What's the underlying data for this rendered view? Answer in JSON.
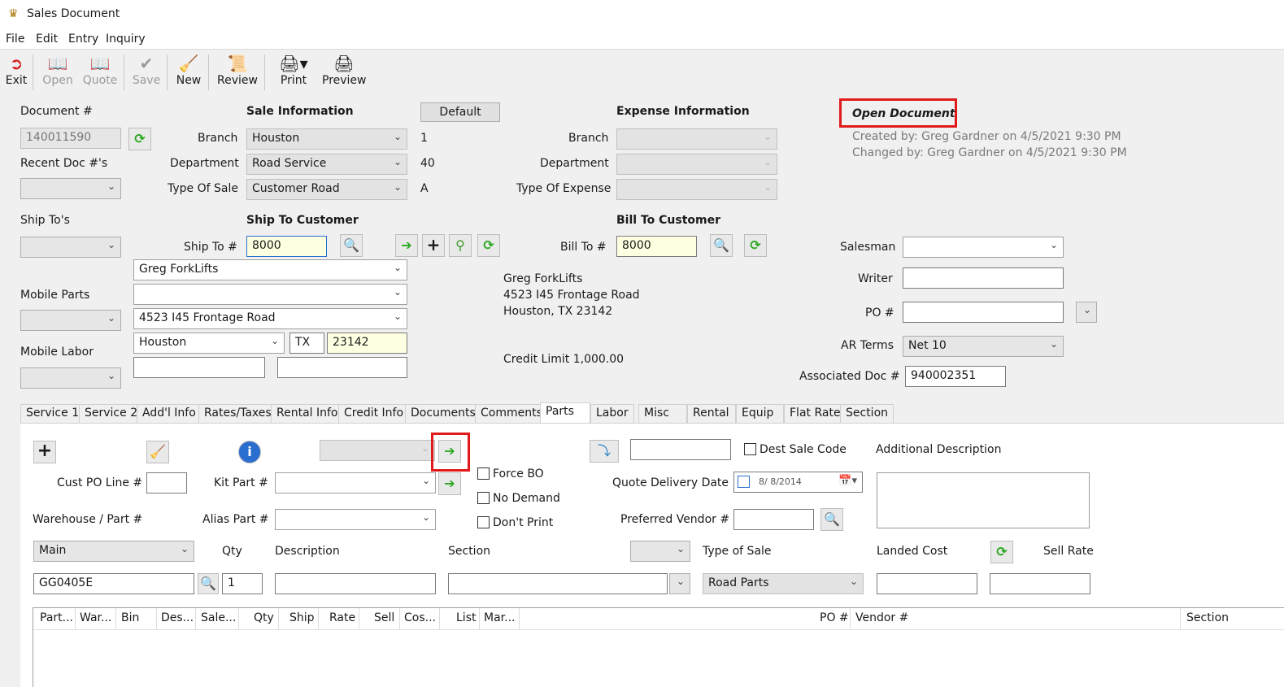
{
  "window": {
    "title": "Sales Document"
  },
  "menu": [
    "File",
    "Edit",
    "Entry",
    "Inquiry"
  ],
  "toolbar": {
    "exit": "Exit",
    "open": "Open",
    "quote": "Quote",
    "save": "Save",
    "new": "New",
    "review": "Review",
    "print": "Print",
    "preview": "Preview"
  },
  "doc": {
    "document_label": "Document #",
    "document_value": "140011590",
    "recent_label": "Recent Doc #'s",
    "shiptos_label": "Ship To's",
    "mobile_parts_label": "Mobile Parts",
    "mobile_labor_label": "Mobile Labor"
  },
  "sale": {
    "heading": "Sale Information",
    "default_btn": "Default",
    "branch_label": "Branch",
    "branch_value": "Houston",
    "branch_code": "1",
    "dept_label": "Department",
    "dept_value": "Road Service",
    "dept_code": "40",
    "type_label": "Type Of Sale",
    "type_value": "Customer Road",
    "type_code": "A"
  },
  "expense": {
    "heading": "Expense Information",
    "branch_label": "Branch",
    "dept_label": "Department",
    "type_label": "Type Of Expense"
  },
  "status": {
    "open_doc": "Open Document",
    "created": "Created by: Greg Gardner on 4/5/2021 9:30 PM",
    "changed": "Changed by: Greg Gardner on 4/5/2021 9:30 PM"
  },
  "shipto": {
    "heading": "Ship To Customer",
    "label": "Ship To #",
    "value": "8000",
    "name": "Greg ForkLifts",
    "addr2": "",
    "address": "4523 I45 Frontage Road",
    "city": "Houston",
    "state": "TX",
    "zip": "23142"
  },
  "billto": {
    "heading": "Bill To Customer",
    "label": "Bill To #",
    "value": "8000",
    "name": "Greg ForkLifts",
    "address": "4523 I45 Frontage Road",
    "citystate": "Houston, TX  23142",
    "credit": "Credit Limit 1,000.00"
  },
  "right": {
    "salesman_label": "Salesman",
    "writer_label": "Writer",
    "po_label": "PO #",
    "arterms_label": "AR Terms",
    "arterms_value": "Net 10",
    "assoc_label": "Associated Doc #",
    "assoc_value": "940002351"
  },
  "tabs": [
    "Service 1",
    "Service 2",
    "Add'l Info",
    "Rates/Taxes",
    "Rental Info",
    "Credit Info",
    "Documents",
    "Comments",
    "Parts",
    "Labor",
    "Misc",
    "Rental",
    "Equip",
    "Flat Rate",
    "Section"
  ],
  "parts": {
    "cust_po_label": "Cust PO Line #",
    "kit_label": "Kit Part #",
    "warehouse_label": "Warehouse / Part #",
    "alias_label": "Alias Part #",
    "force_bo": "Force BO",
    "no_demand": "No Demand",
    "dont_print": "Don't Print",
    "dest_sale": "Dest Sale Code",
    "quote_date_label": "Quote Delivery Date",
    "quote_date_value": "8/  8/2014",
    "pref_vendor_label": "Preferred Vendor #",
    "addl_desc_label": "Additional Description",
    "warehouse_value": "Main",
    "qty_label": "Qty",
    "qty_value": "1",
    "desc_label": "Description",
    "section_label": "Section",
    "type_label": "Type of Sale",
    "type_value": "Road Parts",
    "landed_label": "Landed Cost",
    "sell_label": "Sell Rate",
    "part_value": "GG0405E"
  },
  "grid_headers": [
    "Part...",
    "War...",
    "Bin",
    "Des...",
    "Sale...",
    "Qty",
    "Ship",
    "Rate",
    "Sell",
    "Cos...",
    "List",
    "Mar...",
    "PO #",
    "Vendor #",
    "Section"
  ]
}
